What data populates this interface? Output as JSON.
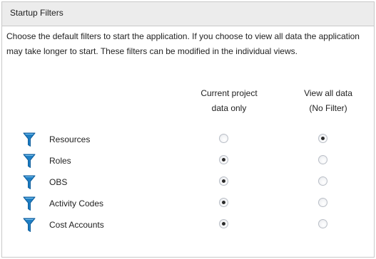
{
  "header": {
    "title": "Startup Filters"
  },
  "description": "Choose the default filters to start the application.  If you choose to view all data the application may take longer to start.  These filters can be modified in the individual views.",
  "columns": [
    {
      "label": "Current project\ndata only"
    },
    {
      "label": "View all data\n(No Filter)"
    }
  ],
  "filters": [
    {
      "label": "Resources",
      "icon": "filter-funnel-icon",
      "selected": "View all data (No Filter)"
    },
    {
      "label": "Roles",
      "icon": "filter-funnel-icon",
      "selected": "Current project data only"
    },
    {
      "label": "OBS",
      "icon": "filter-funnel-icon",
      "selected": "Current project data only"
    },
    {
      "label": "Activity Codes",
      "icon": "filter-funnel-icon",
      "selected": "Current project data only"
    },
    {
      "label": "Cost Accounts",
      "icon": "filter-funnel-icon",
      "selected": "Current project data only"
    }
  ],
  "colors": {
    "header_background": "#ececec",
    "border": "#c9c9c9",
    "icon_blue": "#1f7fc4"
  }
}
